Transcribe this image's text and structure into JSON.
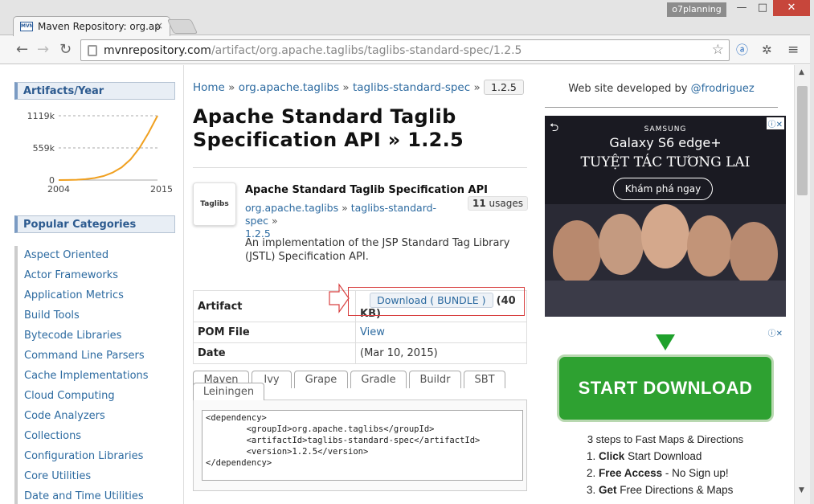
{
  "browser": {
    "tab_title": "Maven Repository: org.ap",
    "tab_close": "×",
    "favicon_text": "MVN",
    "profile": "o7planning",
    "url_host": "mvnrepository.com",
    "url_path": "/artifact/org.apache.taglibs/taglibs-standard-spec/1.2.5",
    "minimize": "—",
    "maximize": "□",
    "close": "✕"
  },
  "sidebar": {
    "artifacts_title": "Artifacts/Year",
    "chart_data": {
      "type": "line",
      "x": [
        2004,
        2005,
        2006,
        2007,
        2008,
        2009,
        2010,
        2011,
        2012,
        2013,
        2014,
        2015
      ],
      "values": [
        0,
        2,
        6,
        15,
        35,
        70,
        130,
        220,
        360,
        560,
        820,
        1119
      ],
      "y_ticks": [
        "1119k",
        "559k",
        "0"
      ],
      "x_ticks": [
        "2004",
        "2015"
      ],
      "ylim": [
        0,
        1119
      ],
      "grid": true,
      "color": "#f0a020"
    },
    "categories_title": "Popular Categories",
    "categories": [
      "Aspect Oriented",
      "Actor Frameworks",
      "Application Metrics",
      "Build Tools",
      "Bytecode Libraries",
      "Command Line Parsers",
      "Cache Implementations",
      "Cloud Computing",
      "Code Analyzers",
      "Collections",
      "Configuration Libraries",
      "Core Utilities",
      "Date and Time Utilities"
    ]
  },
  "main": {
    "breadcrumb": [
      "Home",
      "org.apache.taglibs",
      "taglibs-standard-spec"
    ],
    "breadcrumb_sep": "»",
    "version_badge": "1.2.5",
    "title": "Apache Standard Taglib Specification API » 1.2.5",
    "logo_text": "Taglibs",
    "artifact_name": "Apache Standard Taglib Specification API",
    "artifact_group": "org.apache.taglibs",
    "artifact_id": "taglibs-standard-spec",
    "artifact_version": "1.2.5",
    "usages_count": "11",
    "usages_label": "usages",
    "description": "An implementation of the JSP Standard Tag Library (JSTL) Specification API.",
    "table": {
      "artifact_label": "Artifact",
      "download_label": "Download ( BUNDLE )",
      "size": "(40 KB)",
      "pom_label": "POM File",
      "pom_value": "View",
      "date_label": "Date",
      "date_value": "(Mar 10, 2015)"
    },
    "build_tabs": [
      "Maven",
      "Ivy",
      "Grape",
      "Gradle",
      "Buildr",
      "SBT",
      "Leiningen"
    ],
    "code": "<dependency>\n        <groupId>org.apache.taglibs</groupId>\n        <artifactId>taglibs-standard-spec</artifactId>\n        <version>1.2.5</version>\n</dependency>"
  },
  "right": {
    "dev_text": "Web site developed by",
    "dev_handle": "@frodriguez",
    "ad1": {
      "brand": "SAMSUNG",
      "model": "Galaxy S6 edge+",
      "tagline": "TUYỆT TÁC TƯƠNG LAI",
      "cta": "Khám phá ngay",
      "x_label": "ⓘ✕"
    },
    "ad2": {
      "button": "START DOWNLOAD",
      "x_label": "ⓘ✕",
      "steps_title": "3 steps to Fast Maps & Directions",
      "steps": [
        {
          "num": "1.",
          "bold": "Click",
          "rest": " Start Download"
        },
        {
          "num": "2.",
          "bold": "Free Access",
          "rest": " - No Sign up!"
        },
        {
          "num": "3.",
          "bold": "Get",
          "rest": " Free Directions & Maps"
        }
      ]
    }
  }
}
